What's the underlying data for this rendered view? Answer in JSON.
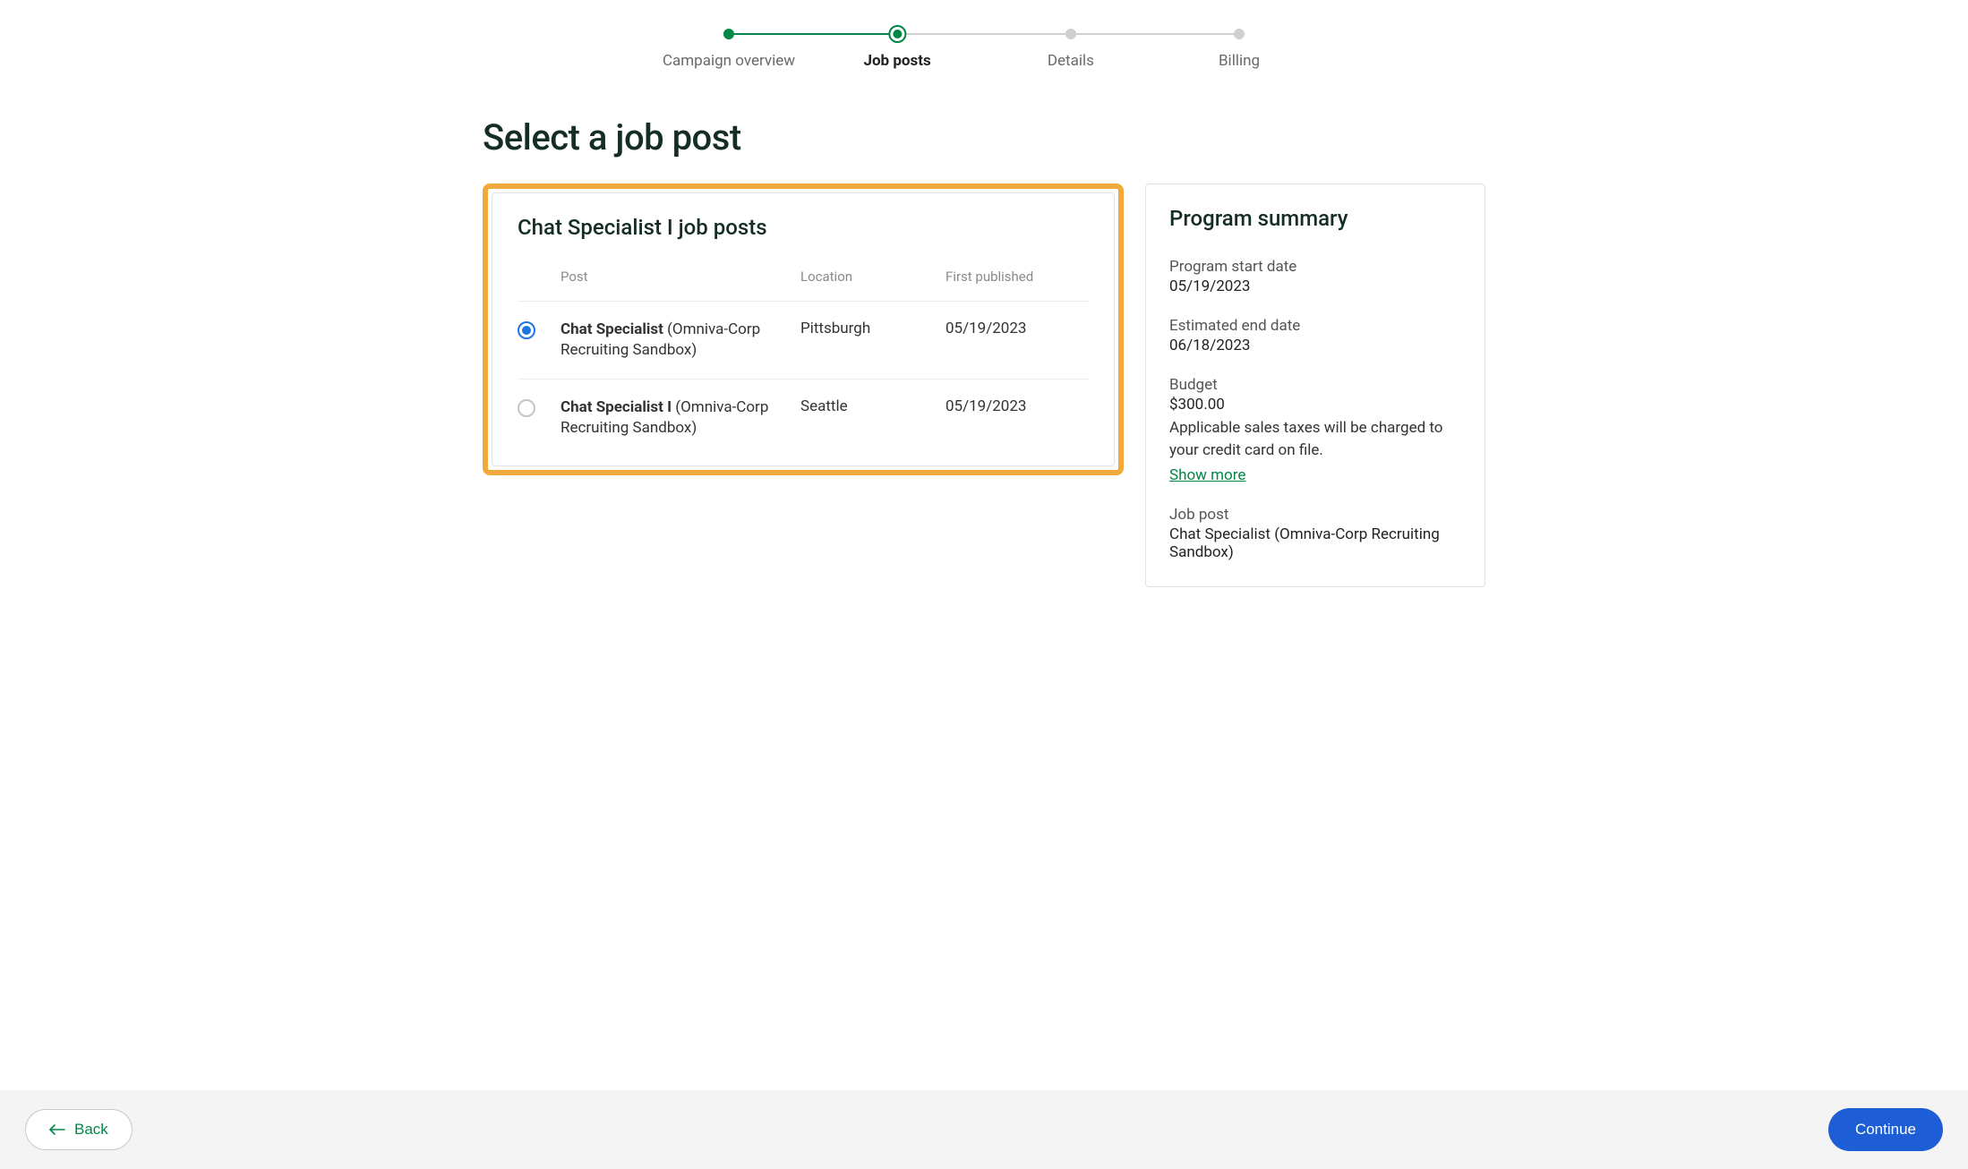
{
  "stepper": {
    "steps": [
      {
        "label": "Campaign overview"
      },
      {
        "label": "Job posts"
      },
      {
        "label": "Details"
      },
      {
        "label": "Billing"
      }
    ]
  },
  "page_title": "Select a job post",
  "posts_panel": {
    "title": "Chat Specialist I job posts",
    "columns": {
      "post": "Post",
      "location": "Location",
      "published": "First published"
    },
    "rows": [
      {
        "title_bold": "Chat Specialist",
        "title_rest": " (Omniva-Corp Recruiting Sandbox)",
        "location": "Pittsburgh",
        "published": "05/19/2023",
        "selected": true
      },
      {
        "title_bold": "Chat Specialist I",
        "title_rest": " (Omniva-Corp Recruiting Sandbox)",
        "location": "Seattle",
        "published": "05/19/2023",
        "selected": false
      }
    ]
  },
  "summary": {
    "title": "Program summary",
    "start_label": "Program start date",
    "start_value": "05/19/2023",
    "end_label": "Estimated end date",
    "end_value": "06/18/2023",
    "budget_label": "Budget",
    "budget_value": "$300.00",
    "tax_note": "Applicable sales taxes will be charged to your credit card on file.",
    "show_more": "Show more",
    "jobpost_label": "Job post",
    "jobpost_value": "Chat Specialist (Omniva-Corp Recruiting Sandbox)"
  },
  "footer": {
    "back": "Back",
    "continue": "Continue"
  }
}
